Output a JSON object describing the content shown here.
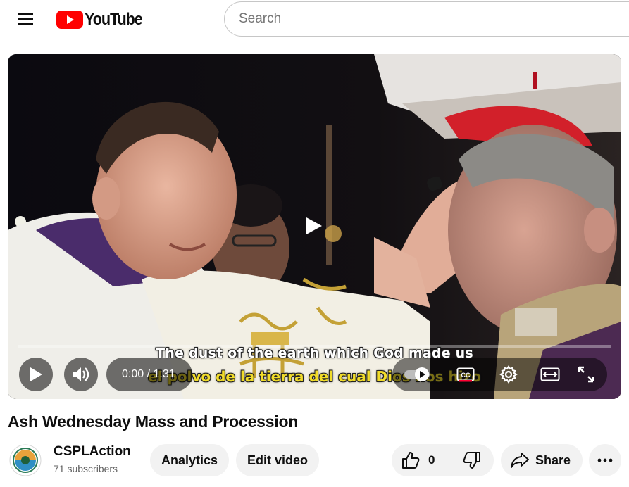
{
  "header": {
    "logo_text": "YouTube",
    "search_placeholder": "Search"
  },
  "player": {
    "caption_en": "The dust of the earth which God made us",
    "caption_es": "el polvo de la tierra del cual Dios nos hizo",
    "time_current": "0:00",
    "time_total": "1:31",
    "time_display": "0:00 / 1:31",
    "progress_fraction": 0.0,
    "autoplay_on": true
  },
  "video": {
    "title": "Ash Wednesday Mass and Procession"
  },
  "channel": {
    "name": "CSPLAction",
    "subscribers": "71 subscribers"
  },
  "actions": {
    "analytics_label": "Analytics",
    "edit_label": "Edit video",
    "like_count": "0",
    "share_label": "Share"
  },
  "colors": {
    "brand_red": "#ff0000",
    "progress_red": "#ff0033",
    "caption_yellow": "#f1dc2a",
    "pill_bg": "#f2f2f2"
  },
  "icons": {
    "menu": "hamburger-menu-icon",
    "logo": "youtube-logo-icon",
    "play": "play-icon",
    "volume": "volume-icon",
    "autoplay": "autoplay-toggle-icon",
    "captions": "closed-captions-icon",
    "settings": "gear-icon",
    "theater": "theater-mode-icon",
    "fullscreen": "fullscreen-icon",
    "like": "thumbs-up-icon",
    "dislike": "thumbs-down-icon",
    "share": "share-arrow-icon",
    "more": "more-dots-icon"
  }
}
